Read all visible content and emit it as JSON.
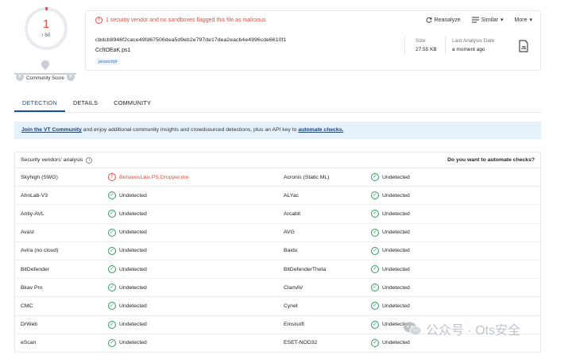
{
  "score": {
    "value": "1",
    "total": "/ 60"
  },
  "community": {
    "label": "Community Score"
  },
  "alert": {
    "text": "1 security vendor and no sandboxes flagged this file as malicious"
  },
  "actions": {
    "reanalyze": "Reanalyze",
    "similar": "Similar",
    "more": "More"
  },
  "file": {
    "hash": "cbdcb8946f2cace49fd67506dea5d9eb2e797de17dea2eacb4e4996cde6610f1",
    "name": "CcftOEaK.ps1",
    "tag": "javascript",
    "size_label": "Size",
    "size_value": "27.55 KB",
    "last_label": "Last Analysis Date",
    "last_value": "a moment ago",
    "type_icon": "JS"
  },
  "tabs": [
    "DETECTION",
    "DETAILS",
    "COMMUNITY"
  ],
  "banner": {
    "link1": "Join the VT Community",
    "middle": " and enjoy additional community insights and crowdsourced detections, plus an API key to ",
    "link2": "automate checks."
  },
  "vendors": {
    "title": "Security vendors' analysis",
    "automate": "Do you want to automate checks?",
    "rows": [
      {
        "name": "Skyhigh (SWG)",
        "result": "BehavesLike.PS.Dropper.mn",
        "status": "malicious",
        "name2": "Acronis (Static ML)",
        "result2": "Undetected",
        "status2": "ok"
      },
      {
        "name": "AhnLab-V3",
        "result": "Undetected",
        "status": "ok",
        "name2": "ALYac",
        "result2": "Undetected",
        "status2": "ok"
      },
      {
        "name": "Antiy-AVL",
        "result": "Undetected",
        "status": "ok",
        "name2": "Arcabit",
        "result2": "Undetected",
        "status2": "ok"
      },
      {
        "name": "Avast",
        "result": "Undetected",
        "status": "ok",
        "name2": "AVG",
        "result2": "Undetected",
        "status2": "ok"
      },
      {
        "name": "Avira (no cloud)",
        "result": "Undetected",
        "status": "ok",
        "name2": "Baidu",
        "result2": "Undetected",
        "status2": "ok"
      },
      {
        "name": "BitDefender",
        "result": "Undetected",
        "status": "ok",
        "name2": "BitDefenderTheta",
        "result2": "Undetected",
        "status2": "ok"
      },
      {
        "name": "Bkav Pro",
        "result": "Undetected",
        "status": "ok",
        "name2": "ClamAV",
        "result2": "Undetected",
        "status2": "ok"
      },
      {
        "name": "CMC",
        "result": "Undetected",
        "status": "ok",
        "name2": "Cynet",
        "result2": "Undetected",
        "status2": "ok"
      },
      {
        "name": "DrWeb",
        "result": "Undetected",
        "status": "ok",
        "name2": "Emsisoft",
        "result2": "Undetected",
        "status2": "ok"
      },
      {
        "name": "eScan",
        "result": "Undetected",
        "status": "ok",
        "name2": "ESET-NOD32",
        "result2": "Undetected",
        "status2": "ok"
      }
    ]
  },
  "watermark": {
    "text": "公众号 · Ots安全"
  },
  "colors": {
    "malicious": "#e74c3c",
    "ok": "#2e9c5b",
    "accent": "#1a4fa3",
    "banner_bg": "#e5f1fb"
  }
}
